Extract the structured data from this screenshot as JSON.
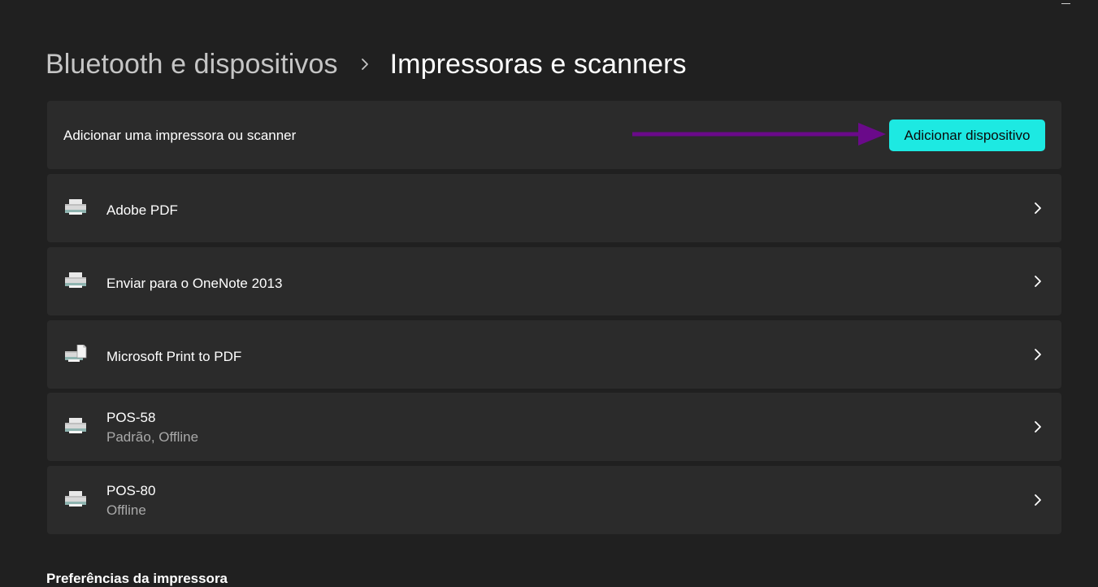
{
  "breadcrumb": {
    "parent": "Bluetooth e dispositivos",
    "current": "Impressoras e scanners"
  },
  "add_device": {
    "label": "Adicionar uma impressora ou scanner",
    "button": "Adicionar dispositivo",
    "button_color": "#1de9e2",
    "annotation_arrow_color": "#6a0a8a"
  },
  "printers": [
    {
      "name": "Adobe PDF",
      "status": "",
      "icon": "printer-icon"
    },
    {
      "name": "Enviar para o OneNote 2013",
      "status": "",
      "icon": "printer-icon"
    },
    {
      "name": "Microsoft Print to PDF",
      "status": "",
      "icon": "printer-document-icon"
    },
    {
      "name": "POS-58",
      "status": "Padrão, Offline",
      "icon": "printer-icon"
    },
    {
      "name": "POS-80",
      "status": "Offline",
      "icon": "printer-icon"
    }
  ],
  "sections": {
    "printer_preferences": "Preferências da impressora"
  },
  "colors": {
    "background": "#202020",
    "card": "#2b2b2b",
    "secondary_text": "#a9a9a9"
  }
}
